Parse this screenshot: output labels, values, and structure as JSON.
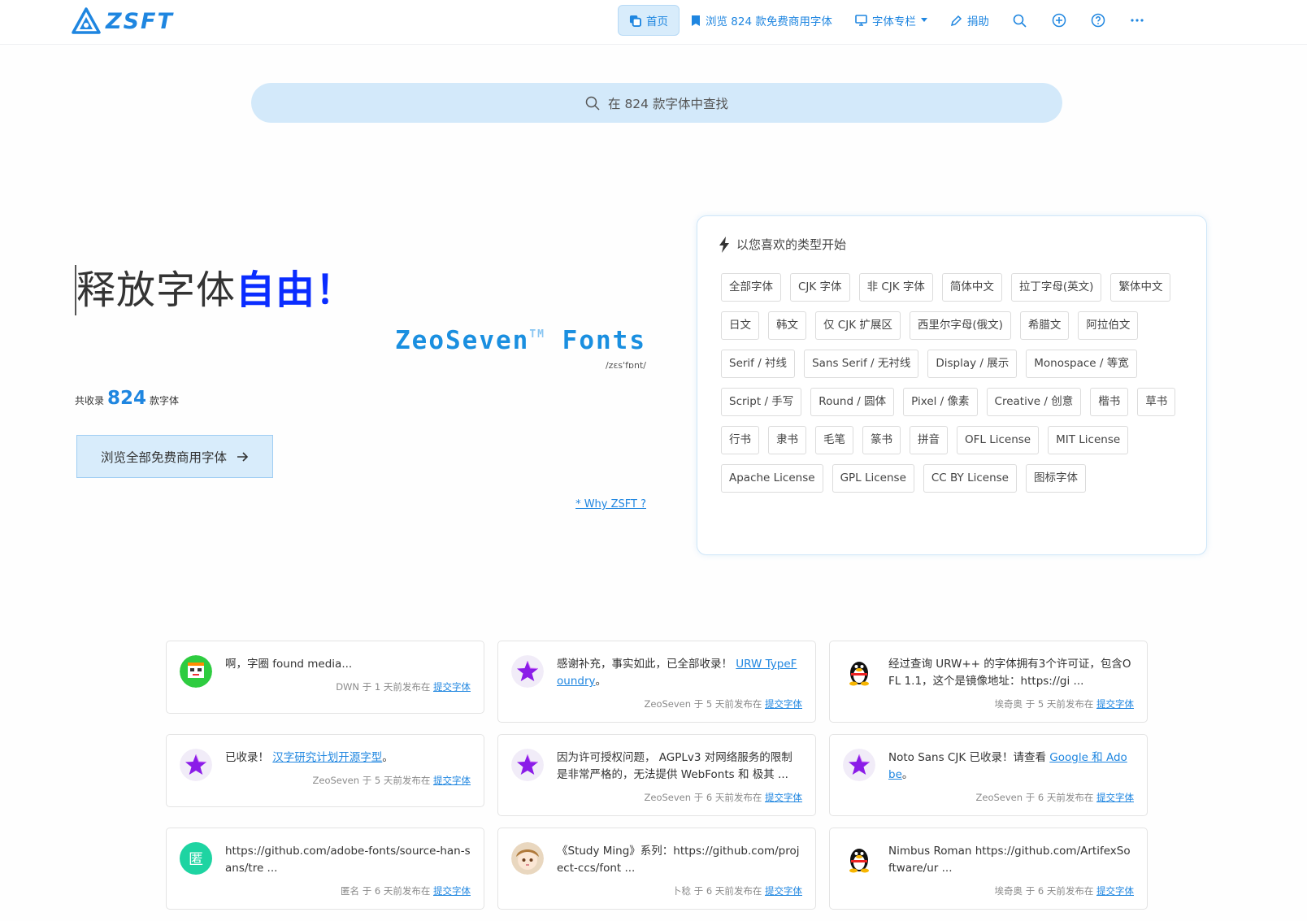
{
  "header": {
    "logo_text": "ZSFT",
    "nav": [
      {
        "label": "首页",
        "icon": "copy-icon",
        "active": true
      },
      {
        "label": "浏览 824 款免费商用字体",
        "icon": "bookmark-icon"
      },
      {
        "label": "字体专栏",
        "icon": "monitor-icon",
        "dropdown": true
      },
      {
        "label": "捐助",
        "icon": "pen-icon"
      }
    ],
    "icon_buttons": [
      "search-icon",
      "plus-circle-icon",
      "help-circle-icon",
      "more-icon"
    ]
  },
  "search": {
    "placeholder": "在 824 款字体中查找"
  },
  "hero": {
    "title_plain": "释放字体",
    "title_strong": "自由！",
    "brand_part1": "Zeo",
    "brand_part2": "Seven",
    "brand_tm": "TM",
    "brand_part3": "Fonts",
    "phonetic": "/zɛs'fɒnt/",
    "count_prefix": "共收录",
    "count_value": "824",
    "count_suffix": "款字体",
    "browse_button": "浏览全部免费商用字体",
    "why_link": "* Why ZSFT ?"
  },
  "categories": {
    "heading": "以您喜欢的类型开始",
    "tags": [
      "全部字体",
      "CJK 字体",
      "非 CJK 字体",
      "简体中文",
      "拉丁字母(英文)",
      "繁体中文",
      "日文",
      "韩文",
      "仅 CJK 扩展区",
      "西里尔字母(俄文)",
      "希腊文",
      "阿拉伯文",
      "Serif / 衬线",
      "Sans Serif / 无衬线",
      "Display / 展示",
      "Monospace / 等宽",
      "Script / 手写",
      "Round / 圆体",
      "Pixel / 像素",
      "Creative / 创意",
      "楷书",
      "草书",
      "行书",
      "隶书",
      "毛笔",
      "篆书",
      "拼音",
      "OFL License",
      "MIT License",
      "Apache License",
      "GPL License",
      "CC BY License",
      "图标字体"
    ]
  },
  "comments": [
    {
      "text": "啊，字圈 found media...",
      "link": "",
      "after": "",
      "author": "DWN",
      "time": "于 1 天前发布在",
      "target": "提交字体",
      "avatar": "green"
    },
    {
      "text": "感谢补充，事实如此，已全部收录！",
      "link": "URW TypeFoundry",
      "after": "。",
      "author": "ZeoSeven",
      "time": "于 5 天前发布在",
      "target": "提交字体",
      "avatar": "star"
    },
    {
      "text": "经过查询 URW++ 的字体拥有3个许可证，包含OFL 1.1，这个是镜像地址：https://gi ...",
      "link": "",
      "after": "",
      "author": "埃奇奥",
      "time": "于 5 天前发布在",
      "target": "提交字体",
      "avatar": "penguin"
    },
    {
      "text": "已收录！",
      "link": "汉字研究计划开源字型",
      "after": "。",
      "author": "ZeoSeven",
      "time": "于 5 天前发布在",
      "target": "提交字体",
      "avatar": "star"
    },
    {
      "text": "因为许可授权问题， AGPLv3 对网络服务的限制是非常严格的，无法提供 WebFonts 和 极其 ...",
      "link": "",
      "after": "",
      "author": "ZeoSeven",
      "time": "于 6 天前发布在",
      "target": "提交字体",
      "avatar": "star"
    },
    {
      "text": "Noto Sans CJK 已收录！请查看",
      "link": "Google 和 Adobe",
      "after": "。",
      "author": "ZeoSeven",
      "time": "于 6 天前发布在",
      "target": "提交字体",
      "avatar": "star"
    },
    {
      "text": "https://github.com/adobe-fonts/source-han-sans/tre ...",
      "link": "",
      "after": "",
      "author": "匿名",
      "time": "于 6 天前发布在",
      "target": "提交字体",
      "avatar": "anon",
      "avatar_char": "匿"
    },
    {
      "text": "《Study Ming》系列：https://github.com/project-ccs/font ...",
      "link": "",
      "after": "",
      "author": "卜稔",
      "time": "于 6 天前发布在",
      "target": "提交字体",
      "avatar": "anime"
    },
    {
      "text": "Nimbus Roman https://github.com/ArtifexSoftware/ur ...",
      "link": "",
      "after": "",
      "author": "埃奇奥",
      "time": "于 6 天前发布在",
      "target": "提交字体",
      "avatar": "penguin"
    }
  ],
  "colors": {
    "accent": "#1f86e0",
    "strong": "#0a2cff",
    "search_bg": "#d3e9fa"
  }
}
